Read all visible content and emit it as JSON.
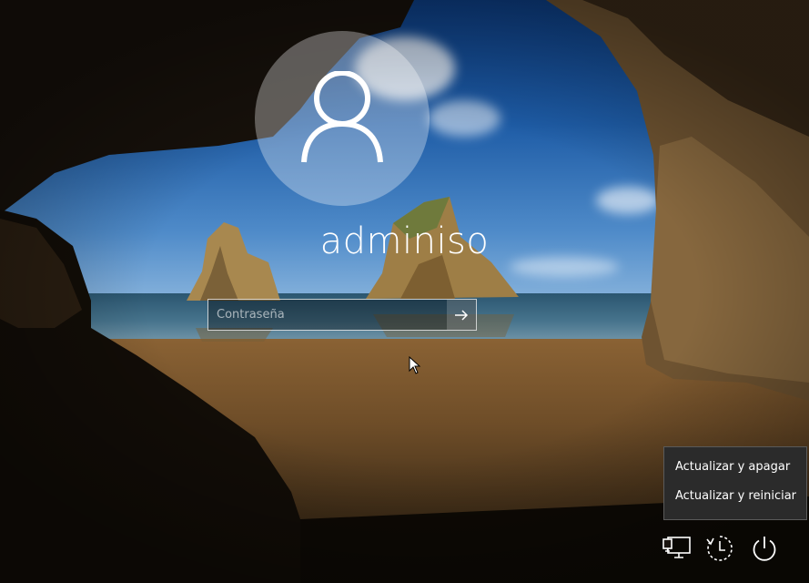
{
  "user": {
    "name": "adminiso"
  },
  "password": {
    "placeholder": "Contraseña",
    "value": ""
  },
  "power_menu": {
    "items": [
      {
        "label": "Actualizar y apagar"
      },
      {
        "label": "Actualizar y reiniciar"
      }
    ]
  },
  "tray": {
    "icons": [
      "network-icon",
      "ease-of-access-icon",
      "power-icon"
    ]
  },
  "colors": {
    "avatar_circle": "rgba(255,255,255,0.32)",
    "menu_background": "#2b2b2b",
    "text": "#ffffff"
  }
}
